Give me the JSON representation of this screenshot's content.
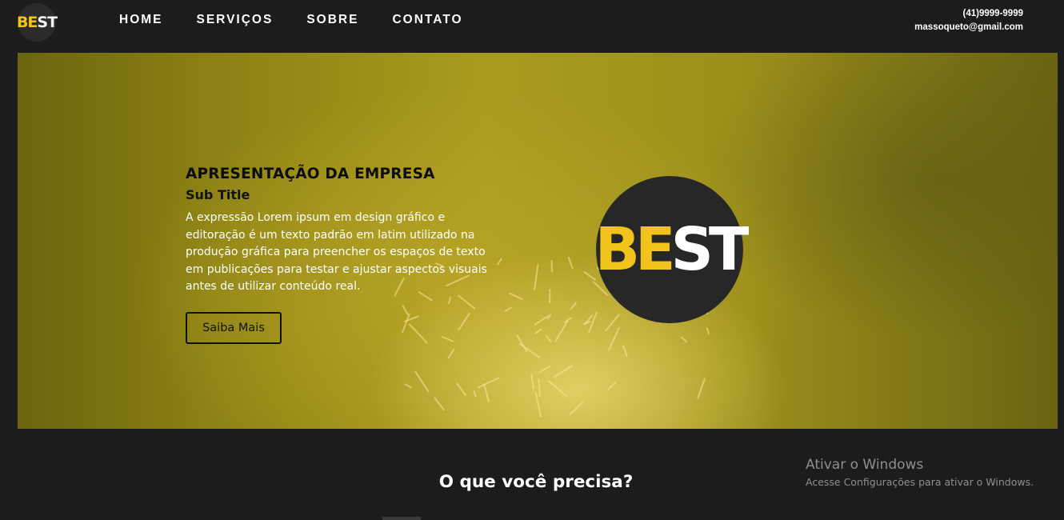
{
  "header": {
    "logo": {
      "be": "BE",
      "st": "ST"
    },
    "nav": [
      "HOME",
      "SERVIÇOS",
      "SOBRE",
      "CONTATO"
    ],
    "phone": "(41)9999-9999",
    "email": "massoqueto@gmail.com"
  },
  "hero": {
    "title": "APRESENTAÇÃO DA EMPRESA",
    "subtitle": "Sub Title",
    "description": "A expressão Lorem ipsum em design gráfico e editoração é um texto padrão em latim utilizado na produção gráfica para preencher os espaços de texto em publicações para testar e ajustar aspectos visuais antes de utilizar conteúdo real.",
    "button_label": "Saiba Mais",
    "logo": {
      "be": "BE",
      "st": "ST"
    }
  },
  "section": {
    "title": "O que você precisa?"
  },
  "watermark": {
    "title": "Ativar o Windows",
    "desc": "Acesse Configurações para ativar o Windows."
  },
  "colors": {
    "background": "#1c1c1c",
    "accent_yellow": "#f2c31b",
    "hero_overlay": "#a99b1f"
  }
}
